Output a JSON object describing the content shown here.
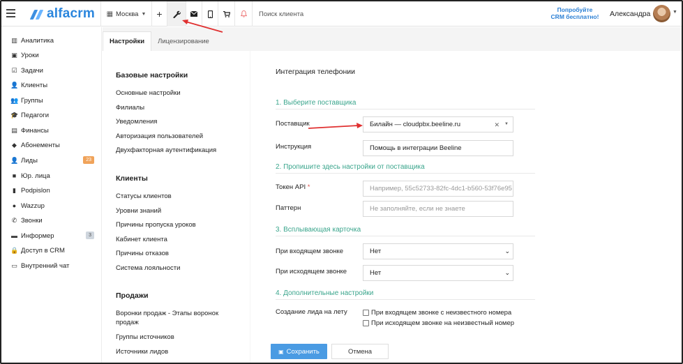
{
  "topbar": {
    "logo_text": "alfacrm",
    "city": "Москва",
    "add_label": "+",
    "search_placeholder": "Поиск клиента",
    "promo_line1": "Попробуйте",
    "promo_line2": "CRM бесплатно!",
    "user_name": "Александра"
  },
  "sidebar": {
    "items": [
      {
        "label": "Аналитика",
        "icon": "chart-icon",
        "glyph": "▥"
      },
      {
        "label": "Уроки",
        "icon": "calendar-icon",
        "glyph": "▣"
      },
      {
        "label": "Задачи",
        "icon": "tasks-icon",
        "glyph": "☑"
      },
      {
        "label": "Клиенты",
        "icon": "user-icon",
        "glyph": "👤"
      },
      {
        "label": "Группы",
        "icon": "users-icon",
        "glyph": "👥"
      },
      {
        "label": "Педагоги",
        "icon": "graduation-cap-icon",
        "glyph": "🎓"
      },
      {
        "label": "Финансы",
        "icon": "money-icon",
        "glyph": "▤"
      },
      {
        "label": "Абонементы",
        "icon": "tag-icon",
        "glyph": "◆"
      },
      {
        "label": "Лиды",
        "icon": "user-plus-icon",
        "glyph": "👤",
        "badge": "23"
      },
      {
        "label": "Юр. лица",
        "icon": "briefcase-icon",
        "glyph": "■"
      },
      {
        "label": "Podpislon",
        "icon": "document-icon",
        "glyph": "▮"
      },
      {
        "label": "Wazzup",
        "icon": "whatsapp-icon",
        "glyph": "●"
      },
      {
        "label": "Звонки",
        "icon": "phone-icon",
        "glyph": "✆"
      },
      {
        "label": "Информер",
        "icon": "informer-icon",
        "glyph": "▬",
        "badge": "3"
      },
      {
        "label": "Доступ в CRM",
        "icon": "lock-icon",
        "glyph": "🔒"
      },
      {
        "label": "Внутренний чат",
        "icon": "chat-icon",
        "glyph": "▭"
      }
    ],
    "lead_badge_color": "#f0a35a",
    "informer_badge_color": "#cfd6de"
  },
  "tabs": [
    "Настройки",
    "Лицензирование"
  ],
  "settings_menu": {
    "sections": [
      {
        "title": "Базовые настройки",
        "links": [
          "Основные настройки",
          "Филиалы",
          "Уведомления",
          "Авторизация пользователей",
          "Двухфакторная аутентификация"
        ]
      },
      {
        "title": "Клиенты",
        "links": [
          "Статусы клиентов",
          "Уровни знаний",
          "Причины пропуска уроков",
          "Кабинет клиента",
          "Причины отказов",
          "Система лояльности"
        ]
      },
      {
        "title": "Продажи",
        "links": [
          "Воронки продаж - Этапы воронок продаж",
          "Группы источников",
          "Источники лидов"
        ]
      }
    ]
  },
  "form": {
    "title": "Интеграция телефонии",
    "section1": "1. Выберите поставщика",
    "provider_label": "Поставщик",
    "provider_value": "Билайн — cloudpbx.beeline.ru",
    "instruction_label": "Инструкция",
    "instruction_value": "Помощь в интеграции Beeline",
    "section2": "2. Пропишите здесь настройки от поставщика",
    "token_label": "Токен API",
    "token_required": "*",
    "token_placeholder": "Например, 55c52733-82fc-4dc1-b560-53f76e95",
    "pattern_label": "Паттерн",
    "pattern_placeholder": "Не заполняйте, если не знаете",
    "section3": "3. Всплывающая карточка",
    "incoming_label": "При входящем звонке",
    "incoming_value": "Нет",
    "outgoing_label": "При исходящем звонке",
    "outgoing_value": "Нет",
    "section4": "4. Дополнительные настройки",
    "lead_label": "Создание лида на лету",
    "check1": "При входящем звонке с неизвестного номера",
    "check2": "При исходящем звонке на неизвестный номер",
    "save_label": "Сохранить",
    "cancel_label": "Отмена"
  },
  "colors": {
    "accent": "#4a9be3",
    "section_green": "#3aa58c",
    "annotation_red": "#e03030"
  }
}
